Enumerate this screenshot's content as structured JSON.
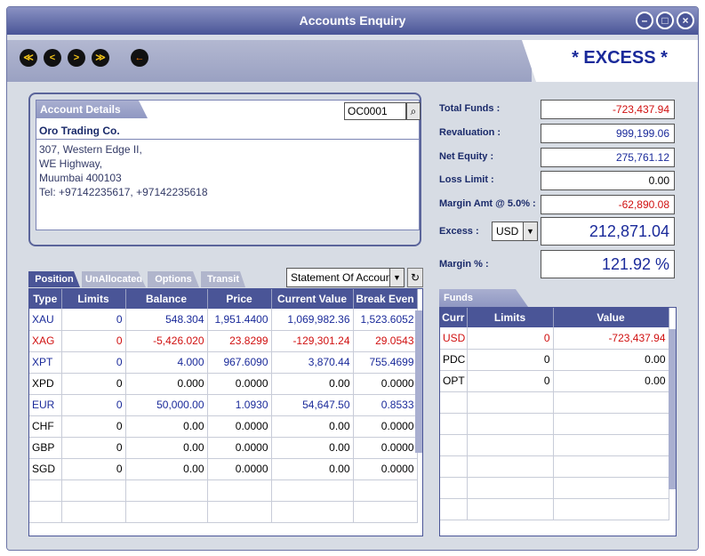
{
  "window": {
    "title": "Accounts Enquiry"
  },
  "toolbar": {
    "first_label": "≪",
    "prev_label": "<",
    "next_label": ">",
    "last_label": "≫",
    "back_label": "←"
  },
  "status_banner": "* EXCESS *",
  "account": {
    "section_label": "Account Details",
    "code": "OC0001",
    "name": "Oro Trading Co.",
    "address": [
      "307, Western Edge II,",
      "WE Highway,",
      "Muumbai 400103",
      "Tel:  +97142235617, +97142235618"
    ]
  },
  "summary": {
    "total_funds": {
      "label": "Total Funds :",
      "value": "-723,437.94"
    },
    "revaluation": {
      "label": "Revaluation :",
      "value": "999,199.06"
    },
    "net_equity": {
      "label": "Net Equity :",
      "value": "275,761.12"
    },
    "loss_limit": {
      "label": "Loss Limit :",
      "value": "0.00"
    },
    "margin_amt": {
      "label": "Margin Amt @ 5.0% :",
      "value": "-62,890.08"
    },
    "excess": {
      "label": "Excess :",
      "currency": "USD",
      "value": "212,871.04"
    },
    "margin_pct": {
      "label": "Margin % :",
      "value": "121.92 %"
    }
  },
  "tabs": {
    "position": "Position",
    "unallocated": "UnAllocated",
    "options": "Options",
    "transit": "Transit"
  },
  "statement_select": "Statement Of Account",
  "positions": {
    "headers": [
      "Type",
      "Limits",
      "Balance",
      "Price",
      "Current Value",
      "Break Even"
    ],
    "rows": [
      {
        "type": "XAU",
        "limits": "0",
        "balance": "548.304",
        "price": "1,951.4400",
        "current_value": "1,069,982.36",
        "break_even": "1,523.6052"
      },
      {
        "type": "XAG",
        "limits": "0",
        "balance": "-5,426.020",
        "price": "23.8299",
        "current_value": "-129,301.24",
        "break_even": "29.0543"
      },
      {
        "type": "XPT",
        "limits": "0",
        "balance": "4.000",
        "price": "967.6090",
        "current_value": "3,870.44",
        "break_even": "755.4699"
      },
      {
        "type": "XPD",
        "limits": "0",
        "balance": "0.000",
        "price": "0.0000",
        "current_value": "0.00",
        "break_even": "0.0000"
      },
      {
        "type": "EUR",
        "limits": "0",
        "balance": "50,000.00",
        "price": "1.0930",
        "current_value": "54,647.50",
        "break_even": "0.8533"
      },
      {
        "type": "CHF",
        "limits": "0",
        "balance": "0.00",
        "price": "0.0000",
        "current_value": "0.00",
        "break_even": "0.0000"
      },
      {
        "type": "GBP",
        "limits": "0",
        "balance": "0.00",
        "price": "0.0000",
        "current_value": "0.00",
        "break_even": "0.0000"
      },
      {
        "type": "SGD",
        "limits": "0",
        "balance": "0.00",
        "price": "0.0000",
        "current_value": "0.00",
        "break_even": "0.0000"
      }
    ]
  },
  "funds": {
    "section_label": "Funds",
    "headers": [
      "Curr",
      "Limits",
      "Value"
    ],
    "rows": [
      {
        "curr": "USD",
        "limits": "0",
        "value": "-723,437.94"
      },
      {
        "curr": "PDC",
        "limits": "0",
        "value": "0.00"
      },
      {
        "curr": "OPT",
        "limits": "0",
        "value": "0.00"
      }
    ]
  },
  "colors": {
    "accent": "#4a5597",
    "negative": "#d01010",
    "positive": "#1a2a9a"
  }
}
